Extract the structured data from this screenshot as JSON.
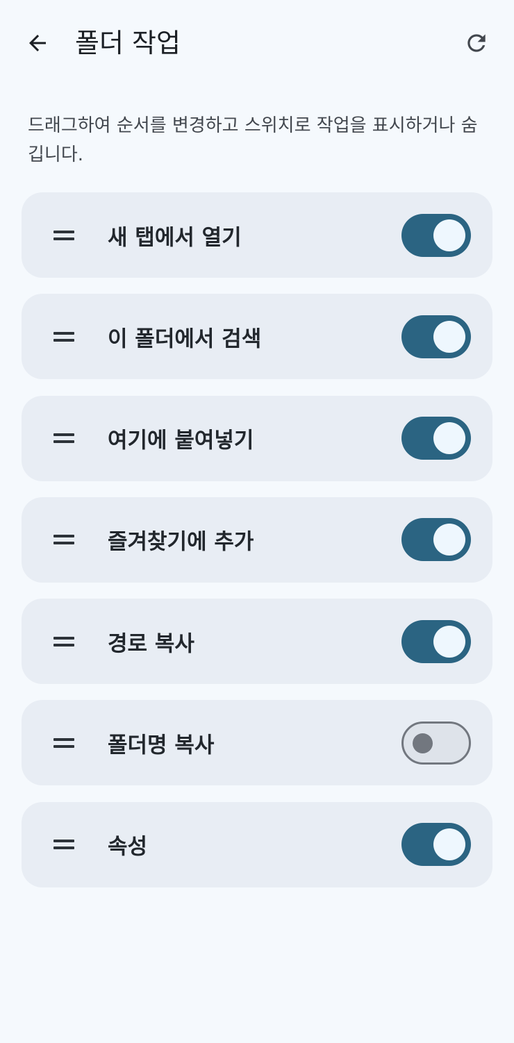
{
  "header": {
    "title": "폴더 작업",
    "back_icon": "arrow-back-icon",
    "reset_icon": "refresh-icon"
  },
  "description": "드래그하여 순서를 변경하고 스위치로 작업을 표시하거나 숨깁니다.",
  "colors": {
    "background": "#f5f9fd",
    "card": "#e8edf4",
    "switch_on": "#2b6482",
    "switch_off_track": "#dee3ea",
    "switch_off_outline": "#72777f"
  },
  "actions": [
    {
      "label": "새 탭에서 열기",
      "enabled": true
    },
    {
      "label": "이 폴더에서 검색",
      "enabled": true
    },
    {
      "label": "여기에 붙여넣기",
      "enabled": true
    },
    {
      "label": "즐겨찾기에 추가",
      "enabled": true
    },
    {
      "label": "경로 복사",
      "enabled": true
    },
    {
      "label": "폴더명 복사",
      "enabled": false
    },
    {
      "label": "속성",
      "enabled": true
    }
  ]
}
